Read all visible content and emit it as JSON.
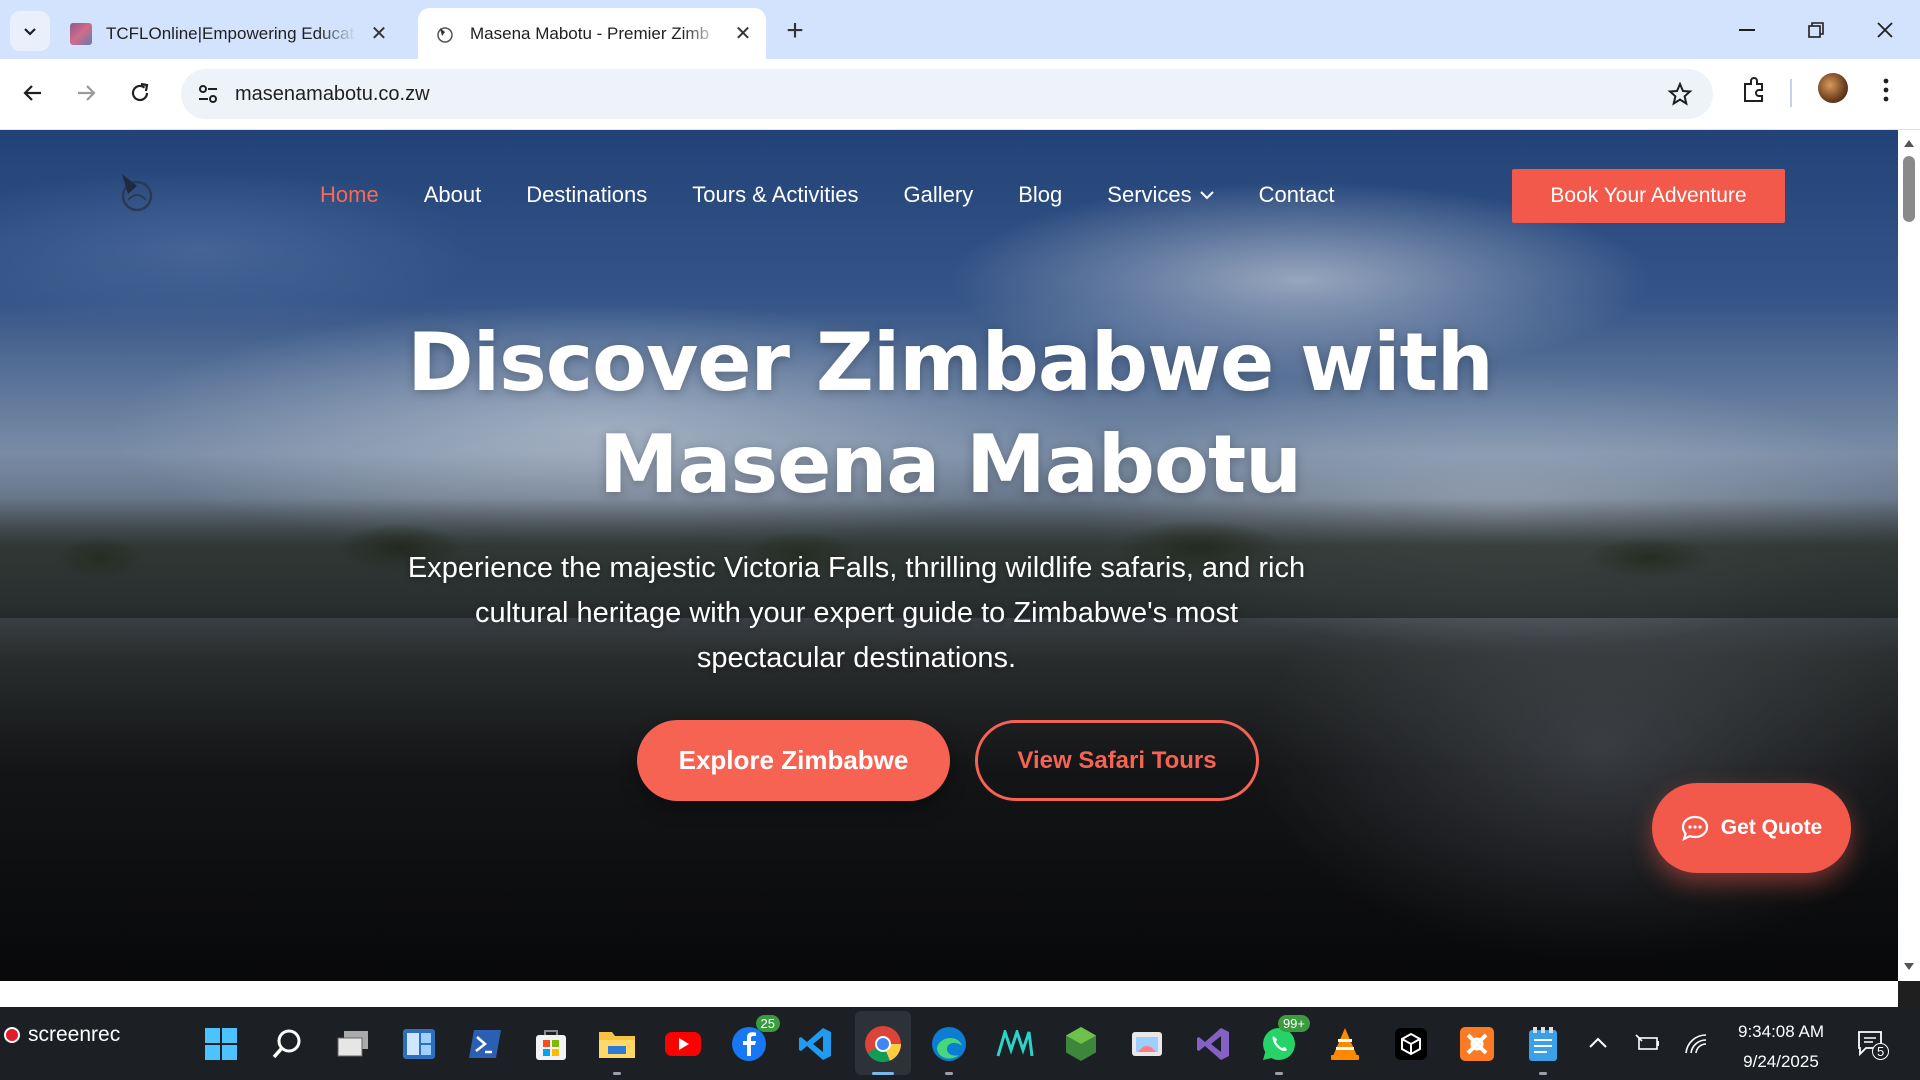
{
  "browser": {
    "tabs": [
      {
        "title": "TCFLOnline|Empowering Educat",
        "active": false
      },
      {
        "title": "Masena Mabotu - Premier Zimb",
        "active": true
      }
    ],
    "url": "masenamabotu.co.zw"
  },
  "site": {
    "nav": {
      "items": [
        {
          "label": "Home",
          "active": true
        },
        {
          "label": "About"
        },
        {
          "label": "Destinations"
        },
        {
          "label": "Tours & Activities"
        },
        {
          "label": "Gallery"
        },
        {
          "label": "Blog"
        },
        {
          "label": "Services"
        },
        {
          "label": "Contact"
        }
      ],
      "cta": "Book Your Adventure"
    },
    "hero": {
      "title_line1": "Discover Zimbabwe with",
      "title_line2": "Masena Mabotu",
      "subtitle": "Experience the majestic Victoria Falls, thrilling wildlife safaris, and rich cultural heritage with your expert guide to Zimbabwe's most spectacular destinations.",
      "primary_button": "Explore Zimbabwe",
      "secondary_button": "View Safari Tours"
    },
    "floating_button": "Get Quote",
    "colors": {
      "accent": "#f2594a",
      "active_nav": "#f66a55"
    }
  },
  "taskbar": {
    "screenrec": "screenrec",
    "badges": {
      "facebook": "25",
      "whatsapp": "99+",
      "notifications": "5"
    },
    "time": "9:34:08 AM",
    "date": "9/24/2025"
  }
}
